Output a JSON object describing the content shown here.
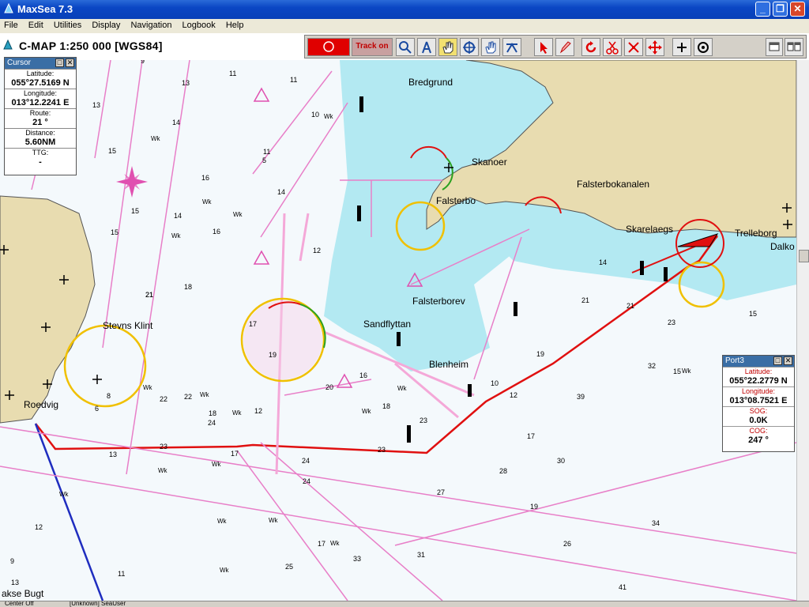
{
  "window": {
    "title": "MaxSea 7.3",
    "minimize": "_",
    "restore": "❐",
    "close": "✕"
  },
  "menu": [
    "File",
    "Edit",
    "Utilities",
    "Display",
    "Navigation",
    "Logbook",
    "Help"
  ],
  "chart_header": {
    "scale_label": "C-MAP  1:250 000 [WGS84]"
  },
  "toolbar": {
    "track_label": "Track on",
    "tools": [
      "record-button",
      "track-on-toggle",
      "zoom-tool",
      "route-tool",
      "hand-tool",
      "target-tool",
      "pan-hand-tool",
      "measure-tool",
      "select-tool",
      "pencil-tool",
      "undo-tool",
      "cut-tool",
      "multi-point-tool",
      "move-tool",
      "crosshair-tool",
      "center-tool",
      "window-tile-button",
      "window-split-button"
    ]
  },
  "cursor_panel": {
    "title": "Cursor",
    "latitude_label": "Latitude:",
    "latitude": "055°27.5169 N",
    "longitude_label": "Longitude:",
    "longitude": "013°12.2241 E",
    "route_label": "Route:",
    "route": "21 °",
    "distance_label": "Distance:",
    "distance": "5.60NM",
    "ttg_label": "TTG:",
    "ttg": "-"
  },
  "port_panel": {
    "title": "Port3",
    "latitude_label": "Latitude:",
    "latitude": "055°22.2779 N",
    "longitude_label": "Longitude:",
    "longitude": "013°08.7521 E",
    "sog_label": "SOG:",
    "sog": "0.0K",
    "cog_label": "COG:",
    "cog": "247 °"
  },
  "map": {
    "place_names": [
      "Bredgrund",
      "Skanoer",
      "Falsterbokanalen",
      "Falsterbo",
      "Skarelaegs",
      "Trelleborg",
      "Dalko",
      "Falsterborev",
      "Sandflyttan",
      "Blenheim",
      "Stevns Klint",
      "Roedvig",
      "akse Bugt"
    ],
    "depths": [
      "9",
      "13",
      "11",
      "13",
      "15",
      "14",
      "16",
      "15",
      "17",
      "12",
      "14",
      "16",
      "21",
      "18",
      "24",
      "23",
      "22",
      "27",
      "33",
      "32",
      "30",
      "28",
      "39",
      "26",
      "41",
      "34",
      "31",
      "25",
      "17",
      "19",
      "12",
      "21",
      "23",
      "20",
      "14",
      "18",
      "19",
      "15",
      "17",
      "21",
      "28",
      "24",
      "9",
      "12",
      "11",
      "13",
      "15",
      "16",
      "14",
      "11",
      "5",
      "11",
      "6",
      "8",
      "10",
      "12",
      "15",
      "13",
      "17",
      "18",
      "10",
      "19",
      "22",
      "23",
      "24",
      "21",
      "23"
    ],
    "wk_label": "Wk",
    "colors": {
      "land": "#e8dcb0",
      "shallow": "#b3e9f2",
      "deep": "#f4f9fc",
      "track": "#e01010",
      "route_pink": "#e87fc8",
      "range_ring": "#f0c000",
      "route_blue": "#1f2dbf"
    }
  },
  "status": {
    "left": "Center Off",
    "right": "[Unknown] SeaUser"
  }
}
